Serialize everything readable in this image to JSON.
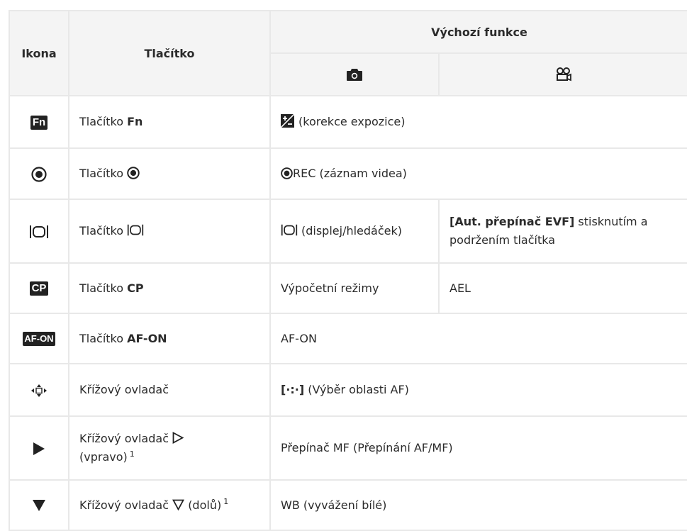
{
  "headers": {
    "icon": "Ikona",
    "button": "Tlačítko",
    "default_function": "Výchozí funkce"
  },
  "rows": [
    {
      "icon": "fn-badge-icon",
      "button_prefix": "Tlačítko ",
      "button_bold": "Fn",
      "func": "(korekce expozice)"
    },
    {
      "icon": "record-icon",
      "button_prefix": "Tlačítko ",
      "func": "REC (záznam videa)"
    },
    {
      "icon": "display-toggle-icon",
      "button_prefix": "Tlačítko ",
      "func_photo": "(displej/hledáček)",
      "func_video_bold": "[Aut. přepínač EVF]",
      "func_video_rest": " stisknutím a podržením tlačítka"
    },
    {
      "icon": "cp-badge-icon",
      "button_prefix": "Tlačítko ",
      "button_bold": "CP",
      "func_photo": "Výpočetní režimy",
      "func_video": "AEL"
    },
    {
      "icon": "af-on-badge-icon",
      "button_prefix": "Tlačítko ",
      "button_bold": "AF-ON",
      "func": "AF-ON"
    },
    {
      "icon": "cross-pad-icon",
      "button": "Křížový ovladač",
      "func_bold": "[·:·]",
      "func": "(Výběr oblasti AF)"
    },
    {
      "icon": "arrow-right-icon",
      "button_line1": "Křížový ovladač",
      "button_line2": "(vpravo)",
      "footnote": "1",
      "func": "Přepínač MF (Přepínání AF/MF)"
    },
    {
      "icon": "arrow-down-icon",
      "button": "Křížový ovladač",
      "button_suffix": "(dolů)",
      "footnote": "1",
      "func": "WB (vyvážení bílé)"
    }
  ],
  "badges": {
    "fn": "Fn",
    "cp": "CP",
    "afon": "AF-ON"
  }
}
